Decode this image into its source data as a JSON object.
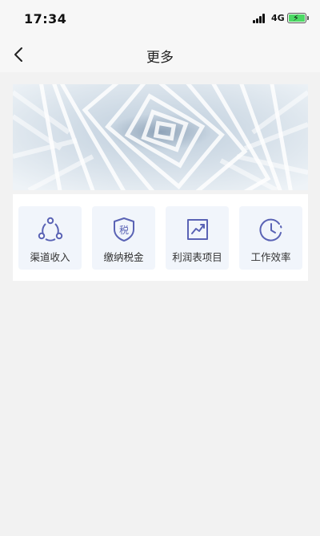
{
  "status_bar": {
    "time": "17:34",
    "network": "4G"
  },
  "nav": {
    "title": "更多"
  },
  "features": [
    {
      "label": "渠道收入",
      "icon": "share-nodes-icon"
    },
    {
      "label": "缴纳税金",
      "icon": "tax-shield-icon",
      "icon_text": "税"
    },
    {
      "label": "利润表项目",
      "icon": "trend-chart-icon"
    },
    {
      "label": "工作效率",
      "icon": "clock-icon"
    }
  ],
  "colors": {
    "accent": "#5a63b5",
    "tile_bg": "#f1f5fb",
    "page_bg": "#f2f2f2"
  }
}
